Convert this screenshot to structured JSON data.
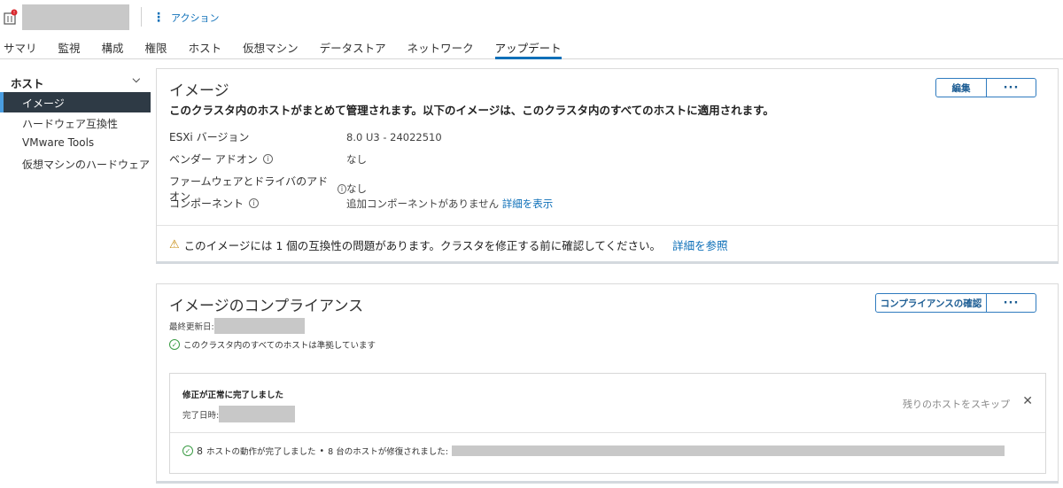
{
  "header": {
    "actions_label": "アクション"
  },
  "tabs": [
    {
      "label": "サマリ"
    },
    {
      "label": "監視"
    },
    {
      "label": "構成"
    },
    {
      "label": "権限"
    },
    {
      "label": "ホスト"
    },
    {
      "label": "仮想マシン"
    },
    {
      "label": "データストア"
    },
    {
      "label": "ネットワーク"
    },
    {
      "label": "アップデート",
      "active": true
    }
  ],
  "sidebar": {
    "heading": "ホスト",
    "items": [
      {
        "label": "イメージ",
        "active": true
      },
      {
        "label": "ハードウェア互換性"
      },
      {
        "label": "VMware Tools"
      },
      {
        "label": "仮想マシンのハードウェア"
      }
    ]
  },
  "image_card": {
    "title": "イメージ",
    "description": "このクラスタ内のホストがまとめて管理されます。以下のイメージは、このクラスタ内のすべてのホストに適用されます。",
    "edit_label": "編集",
    "more_label": "···",
    "rows": [
      {
        "key": "ESXi バージョン",
        "value": "8.0 U3 - 24022510",
        "info": false
      },
      {
        "key": "ベンダー アドオン",
        "value": "なし",
        "info": true
      },
      {
        "key": "ファームウェアとドライバのアドオン",
        "value": "なし",
        "info": true
      },
      {
        "key": "コンポーネント",
        "value": "追加コンポーネントがありません",
        "info": true,
        "link": "詳細を表示"
      }
    ],
    "warning_text": "このイメージには 1 個の互換性の問題があります。クラスタを修正する前に確認してください。",
    "warning_link": "詳細を参照"
  },
  "compliance_card": {
    "title": "イメージのコンプライアンス",
    "check_label": "コンプライアンスの確認",
    "more_label": "···",
    "last_updated_label": "最終更新日:",
    "compliant_text": "このクラスタ内のすべてのホストは準拠しています",
    "remediation": {
      "title": "修正が正常に完了しました",
      "completed_label": "完了日時:",
      "skip_label": "残りのホストをスキップ",
      "close_label": "✕",
      "count": "8",
      "hosts_done_text": "ホストの動作が完了しました",
      "bullet": "•",
      "remediated_text": "8 台のホストが修復されました:"
    }
  },
  "colors": {
    "accent": "#0d6fb8",
    "sidebar_active": "#2e3a45",
    "success": "#3a9b44",
    "warning": "#c58a0d"
  }
}
